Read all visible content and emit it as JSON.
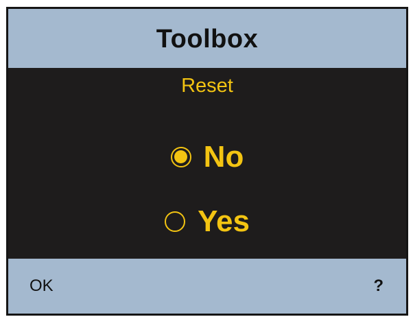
{
  "header": {
    "title": "Toolbox"
  },
  "dialog": {
    "subtitle": "Reset",
    "options": [
      {
        "label": "No",
        "selected": true
      },
      {
        "label": "Yes",
        "selected": false
      }
    ]
  },
  "footer": {
    "left_softkey": "OK",
    "right_softkey": "?"
  },
  "colors": {
    "bar_background": "#a4b9cf",
    "screen_background": "#1e1c1c",
    "accent_yellow": "#f3c412"
  },
  "icons": {
    "selected_option": "radio-checked-icon",
    "unselected_option": "radio-unchecked-icon"
  }
}
